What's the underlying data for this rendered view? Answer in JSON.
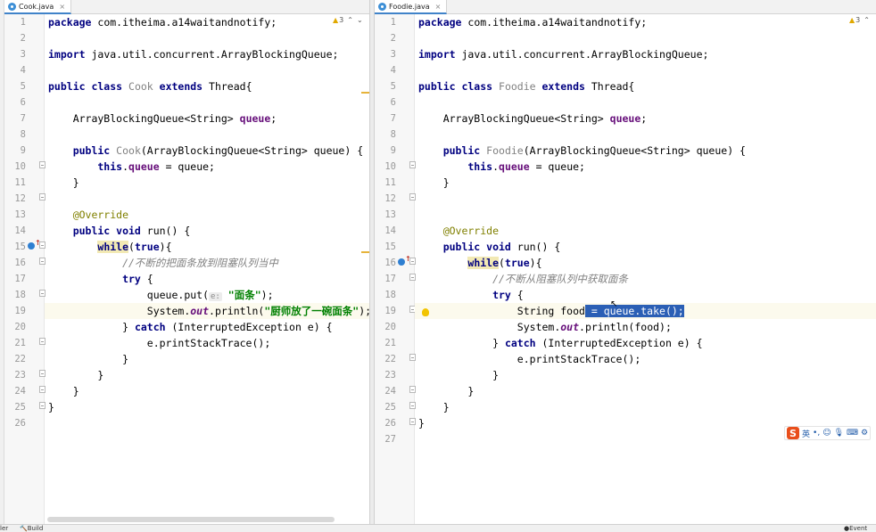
{
  "left_editor": {
    "tab_name": "Cook.java",
    "tab_close": "×",
    "warning_count": "3",
    "warning_symbol": "▲",
    "nav_up": "⌃",
    "nav_down": "⌄",
    "line_numbers": [
      "1",
      "2",
      "3",
      "4",
      "5",
      "6",
      "7",
      "8",
      "9",
      "10",
      "11",
      "12",
      "13",
      "14",
      "15",
      "16",
      "17",
      "18",
      "19",
      "20",
      "21",
      "22",
      "23",
      "24",
      "25",
      "26"
    ],
    "code": {
      "l1_kw": "package",
      "l1_rest": " com.itheima.a14waitandnotify;",
      "l3_kw": "import",
      "l3_rest": " java.util.concurrent.ArrayBlockingQueue;",
      "l5_kw1": "public class",
      "l5_cls": " Cook ",
      "l5_kw2": "extends",
      "l5_rest": " Thread{",
      "l7_type": "    ArrayBlockingQueue<String> ",
      "l7_field": "queue",
      "l7_end": ";",
      "l9_kw": "    public",
      "l9_cls": " Cook",
      "l9_rest": "(ArrayBlockingQueue<String> queue) {",
      "l10_kw": "        this",
      "l10_dot": ".",
      "l10_field": "queue",
      "l10_rest": " = queue;",
      "l11": "    }",
      "l13_ann": "    @Override",
      "l14_kw": "    public void",
      "l14_rest": " run() {",
      "l15_indent": "        ",
      "l15_kw": "while",
      "l15_paren": "(",
      "l15_true": "true",
      "l15_rest": "){",
      "l16_cmt": "            //不断的把面条放到阻塞队列当中",
      "l17_kw": "            try",
      "l17_rest": " {",
      "l18_a": "                queue.put(",
      "l18_hint": "e:",
      "l18_str": "\"面条\"",
      "l18_b": ");",
      "l19_a": "                System.",
      "l19_out": "out",
      "l19_b": ".println(",
      "l19_str": "\"厨师放了一碗面条\"",
      "l19_c": ");",
      "l20_a": "            } ",
      "l20_kw": "catch",
      "l20_b": " (InterruptedException e) {",
      "l21": "                e.printStackTrace();",
      "l22": "            }",
      "l23": "        }",
      "l24": "    }",
      "l25": "}"
    }
  },
  "right_editor": {
    "tab_name": "Foodie.java",
    "tab_close": "×",
    "warning_count": "3",
    "warning_symbol": "▲",
    "nav_up": "⌃",
    "line_numbers": [
      "1",
      "2",
      "3",
      "4",
      "5",
      "6",
      "7",
      "8",
      "9",
      "10",
      "11",
      "12",
      "13",
      "14",
      "15",
      "16",
      "17",
      "18",
      "19",
      "20",
      "21",
      "22",
      "23",
      "24",
      "25",
      "26",
      "27"
    ],
    "code": {
      "l1_kw": "package",
      "l1_rest": " com.itheima.a14waitandnotify;",
      "l3_kw": "import",
      "l3_rest": " java.util.concurrent.ArrayBlockingQueue;",
      "l5_kw1": "public class",
      "l5_cls": " Foodie ",
      "l5_kw2": "extends",
      "l5_rest": " Thread{",
      "l7_type": "    ArrayBlockingQueue<String> ",
      "l7_field": "queue",
      "l7_end": ";",
      "l9_kw": "    public",
      "l9_cls": " Foodie",
      "l9_rest": "(ArrayBlockingQueue<String> queue) {",
      "l10_kw": "        this",
      "l10_dot": ".",
      "l10_field": "queue",
      "l10_rest": " = queue;",
      "l11": "    }",
      "l14_ann": "    @Override",
      "l15_kw": "    public void",
      "l15_rest": " run() {",
      "l16_indent": "        ",
      "l16_kw": "while",
      "l16_paren": "(",
      "l16_true": "true",
      "l16_rest": "){",
      "l17_cmt": "            //不断从阻塞队列中获取面条",
      "l18_kw": "            try",
      "l18_rest": " {",
      "l19_a": "                String food",
      "l19_sel": " = queue.take();",
      "l20_a": "                System.",
      "l20_out": "out",
      "l20_b": ".println(food);",
      "l21_a": "            } ",
      "l21_kw": "catch",
      "l21_b": " (InterruptedException e) {",
      "l22": "                e.printStackTrace();",
      "l23": "            }",
      "l24": "        }",
      "l25": "    }",
      "l26": "}"
    }
  },
  "ime_toolbar": {
    "logo": "S",
    "lang": "英",
    "punct": "•,",
    "emoji": "☺",
    "mic": "🎙",
    "keyboard": "⌨",
    "more": "⚙"
  },
  "statusbar": {
    "left_fragment": "ler",
    "build_label": "Build",
    "right_fragment": "Event L"
  },
  "colors": {
    "keyword": "#000080",
    "field": "#660e7a",
    "annotation": "#808000",
    "comment": "#808080",
    "string": "#008000",
    "selection": "#2b5fb5",
    "current_line": "#fcfaed",
    "tab_underline": "#4083c9"
  }
}
